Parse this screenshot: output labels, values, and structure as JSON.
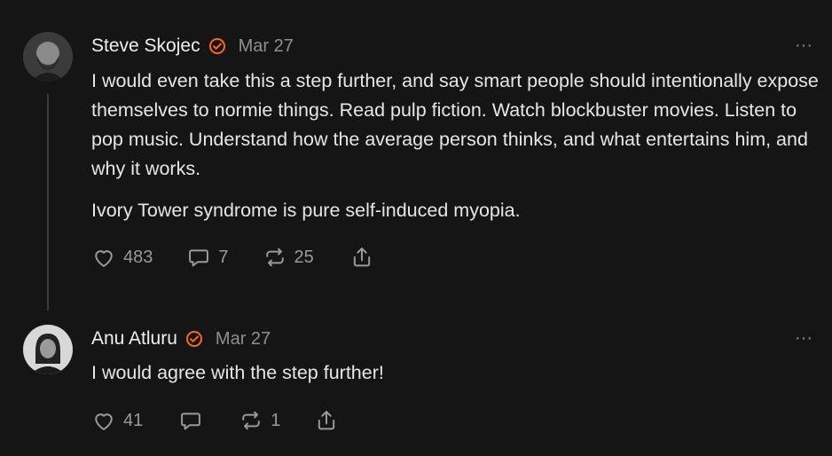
{
  "comments": [
    {
      "author": "Steve Skojec",
      "date": "Mar 27",
      "paragraphs": [
        "I would even take this a step further, and say smart people should intentionally expose themselves to normie things. Read pulp fiction. Watch blockbuster movies. Listen to pop music. Understand how the average person thinks, and what entertains him, and why it works.",
        "Ivory Tower syndrome is pure self-induced myopia."
      ],
      "likes": "483",
      "replies": "7",
      "restacks": "25"
    },
    {
      "author": "Anu Atluru",
      "date": "Mar 27",
      "paragraphs": [
        "I would agree with the step further!"
      ],
      "likes": "41",
      "replies": "",
      "restacks": "1"
    }
  ],
  "more_label": "···",
  "colors": {
    "background": "#151515",
    "verified": "#ff6719",
    "text": "#e6e6e6",
    "muted": "#8f8f8f"
  },
  "icons": [
    "verified-badge-icon",
    "more-icon",
    "heart-icon",
    "comment-icon",
    "restack-icon",
    "share-icon"
  ]
}
